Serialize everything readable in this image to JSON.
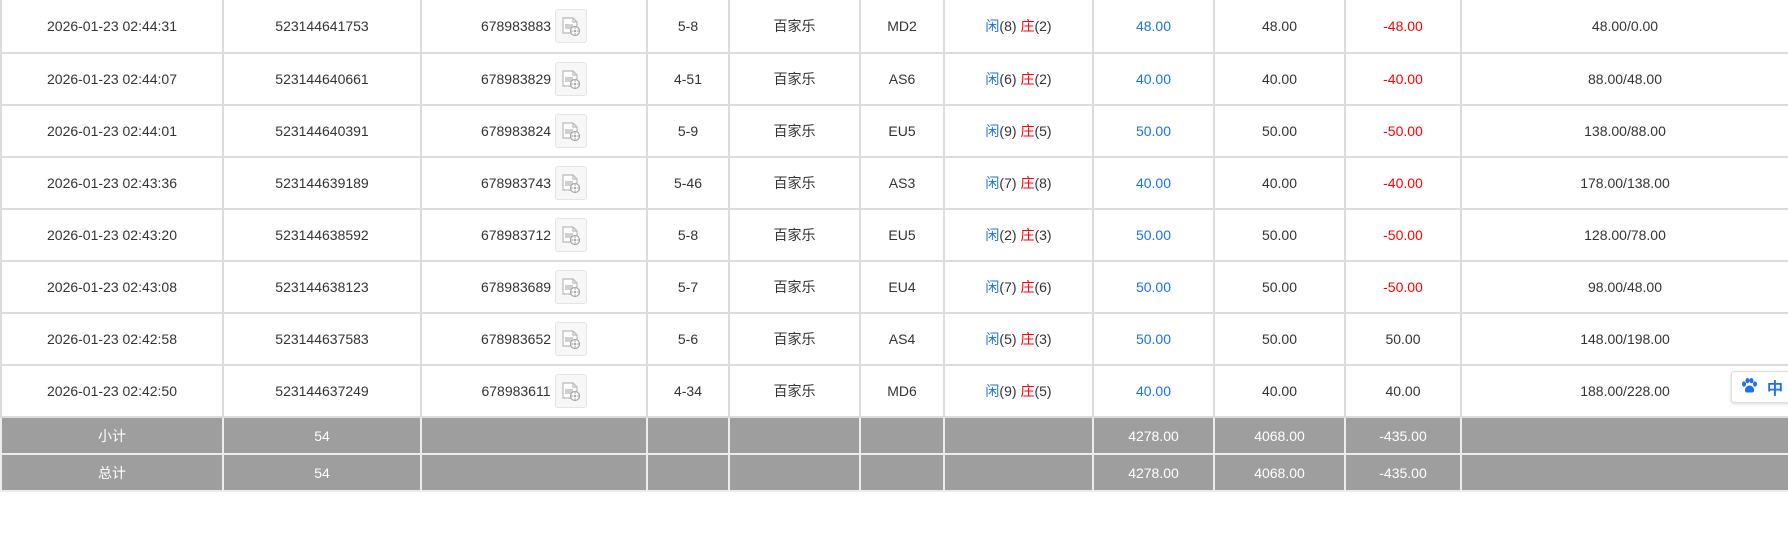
{
  "rows": [
    {
      "time": "2026-01-23 02:44:31",
      "bet_id": "523144641753",
      "round_id": "678983883",
      "shoe": "5-8",
      "game": "百家乐",
      "table": "MD2",
      "result": {
        "player_label": "闲",
        "player_score": "(8)",
        "banker_label": "庄",
        "banker_score": "(2)"
      },
      "bet": "48.00",
      "valid": "48.00",
      "payout": "-48.00",
      "payout_negative": true,
      "balance": "48.00/0.00"
    },
    {
      "time": "2026-01-23 02:44:07",
      "bet_id": "523144640661",
      "round_id": "678983829",
      "shoe": "4-51",
      "game": "百家乐",
      "table": "AS6",
      "result": {
        "player_label": "闲",
        "player_score": "(6)",
        "banker_label": "庄",
        "banker_score": "(2)"
      },
      "bet": "40.00",
      "valid": "40.00",
      "payout": "-40.00",
      "payout_negative": true,
      "balance": "88.00/48.00"
    },
    {
      "time": "2026-01-23 02:44:01",
      "bet_id": "523144640391",
      "round_id": "678983824",
      "shoe": "5-9",
      "game": "百家乐",
      "table": "EU5",
      "result": {
        "player_label": "闲",
        "player_score": "(9)",
        "banker_label": "庄",
        "banker_score": "(5)"
      },
      "bet": "50.00",
      "valid": "50.00",
      "payout": "-50.00",
      "payout_negative": true,
      "balance": "138.00/88.00"
    },
    {
      "time": "2026-01-23 02:43:36",
      "bet_id": "523144639189",
      "round_id": "678983743",
      "shoe": "5-46",
      "game": "百家乐",
      "table": "AS3",
      "result": {
        "player_label": "闲",
        "player_score": "(7)",
        "banker_label": "庄",
        "banker_score": "(8)"
      },
      "bet": "40.00",
      "valid": "40.00",
      "payout": "-40.00",
      "payout_negative": true,
      "balance": "178.00/138.00"
    },
    {
      "time": "2026-01-23 02:43:20",
      "bet_id": "523144638592",
      "round_id": "678983712",
      "shoe": "5-8",
      "game": "百家乐",
      "table": "EU5",
      "result": {
        "player_label": "闲",
        "player_score": "(2)",
        "banker_label": "庄",
        "banker_score": "(3)"
      },
      "bet": "50.00",
      "valid": "50.00",
      "payout": "-50.00",
      "payout_negative": true,
      "balance": "128.00/78.00"
    },
    {
      "time": "2026-01-23 02:43:08",
      "bet_id": "523144638123",
      "round_id": "678983689",
      "shoe": "5-7",
      "game": "百家乐",
      "table": "EU4",
      "result": {
        "player_label": "闲",
        "player_score": "(7)",
        "banker_label": "庄",
        "banker_score": "(6)"
      },
      "bet": "50.00",
      "valid": "50.00",
      "payout": "-50.00",
      "payout_negative": true,
      "balance": "98.00/48.00"
    },
    {
      "time": "2026-01-23 02:42:58",
      "bet_id": "523144637583",
      "round_id": "678983652",
      "shoe": "5-6",
      "game": "百家乐",
      "table": "AS4",
      "result": {
        "player_label": "闲",
        "player_score": "(5)",
        "banker_label": "庄",
        "banker_score": "(3)"
      },
      "bet": "50.00",
      "valid": "50.00",
      "payout": "50.00",
      "payout_negative": false,
      "balance": "148.00/198.00"
    },
    {
      "time": "2026-01-23 02:42:50",
      "bet_id": "523144637249",
      "round_id": "678983611",
      "shoe": "4-34",
      "game": "百家乐",
      "table": "MD6",
      "result": {
        "player_label": "闲",
        "player_score": "(9)",
        "banker_label": "庄",
        "banker_score": "(5)"
      },
      "bet": "40.00",
      "valid": "40.00",
      "payout": "40.00",
      "payout_negative": false,
      "balance": "188.00/228.00"
    }
  ],
  "subtotal": {
    "label": "小计",
    "count": "54",
    "bet": "4278.00",
    "valid": "4068.00",
    "payout": "-435.00"
  },
  "total": {
    "label": "总计",
    "count": "54",
    "bet": "4278.00",
    "valid": "4068.00",
    "payout": "-435.00"
  },
  "float_tool": {
    "label": "中"
  },
  "icons": {
    "replay": "video-replay-icon",
    "paw": "paw-icon"
  },
  "colors": {
    "player": "#1a73e8",
    "banker": "#ff0000",
    "negative": "#ff0000",
    "summary_bg": "#9e9e9e"
  }
}
